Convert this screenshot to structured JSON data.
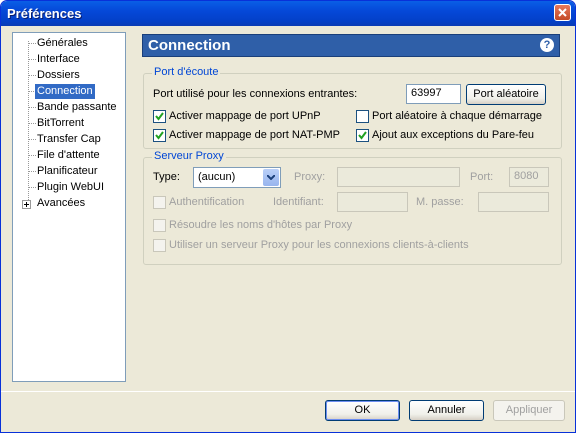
{
  "window": {
    "title": "Préférences"
  },
  "tree": {
    "items": [
      {
        "label": "Générales"
      },
      {
        "label": "Interface"
      },
      {
        "label": "Dossiers"
      },
      {
        "label": "Connection",
        "selected": true
      },
      {
        "label": "Bande passante"
      },
      {
        "label": "BitTorrent"
      },
      {
        "label": "Transfer Cap"
      },
      {
        "label": "File d'attente"
      },
      {
        "label": "Planificateur"
      },
      {
        "label": "Plugin WebUI"
      },
      {
        "label": "Avancées",
        "expandable": true
      }
    ]
  },
  "header": {
    "title": "Connection",
    "help_icon": "?"
  },
  "listening": {
    "title": "Port d'écoute",
    "port_label": "Port utilisé pour les connexions entrantes:",
    "port_value": "63997",
    "random_button": "Port aléatoire",
    "upnp_label": "Activer mappage de port UPnP",
    "upnp_checked": true,
    "random_start_label": "Port aléatoire à chaque démarrage",
    "random_start_checked": false,
    "natpmp_label": "Activer mappage de port NAT-PMP",
    "natpmp_checked": true,
    "firewall_label": "Ajout aux exceptions du Pare-feu",
    "firewall_checked": true
  },
  "proxy": {
    "title": "Serveur Proxy",
    "type_label": "Type:",
    "type_value": "(aucun)",
    "proxy_label": "Proxy:",
    "proxy_value": "",
    "port_label": "Port:",
    "port_value": "8080",
    "auth_label": "Authentification",
    "username_label": "Identifiant:",
    "username_value": "",
    "password_label": "M. passe:",
    "password_value": "",
    "resolve_label": "Résoudre les noms d'hôtes par Proxy",
    "peer_label": "Utiliser un serveur Proxy pour les connexions clients-à-clients"
  },
  "buttons": {
    "ok": "OK",
    "cancel": "Annuler",
    "apply": "Appliquer"
  },
  "colors": {
    "accent": "#2f5fa8",
    "titlebar": "#0548d8",
    "group_title": "#0046d5",
    "selection": "#316ac5"
  }
}
